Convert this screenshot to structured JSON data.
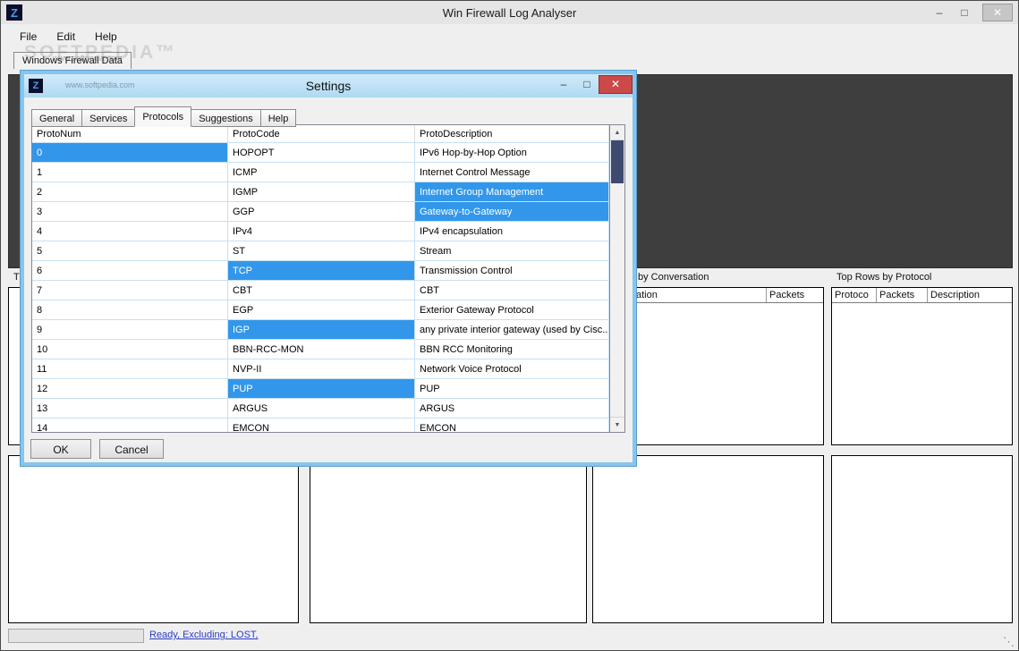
{
  "window": {
    "title": "Win Firewall Log Analyser",
    "menu_items": [
      "File",
      "Edit",
      "Help"
    ],
    "tab_label": "Windows Firewall Data",
    "watermark_large": "SOFTPEDIA™",
    "watermark_small": "www.softpedia.com",
    "controls": {
      "minimize": "–",
      "maximize": "□",
      "close": "✕"
    }
  },
  "panels": {
    "left": {
      "title_fragment": "T"
    },
    "conversation": {
      "title_fragment": "by Conversation",
      "col1_fragment": "ation",
      "col2": "Packets"
    },
    "protocol": {
      "title": "Top Rows by Protocol",
      "columns": [
        "Protoco",
        "Packets",
        "Description"
      ]
    }
  },
  "statusbar": {
    "link": "Ready, Excluding: LOST,"
  },
  "dialog": {
    "title": "Settings",
    "tabs": [
      "General",
      "Services",
      "Protocols",
      "Suggestions",
      "Help"
    ],
    "active_tab": "Protocols",
    "controls": {
      "minimize": "–",
      "maximize": "□",
      "close": "✕"
    },
    "scroll": {
      "up": "▲",
      "down": "▼"
    },
    "table": {
      "columns": [
        "ProtoNum",
        "ProtoCode",
        "ProtoDescription"
      ],
      "rows": [
        {
          "num": "0",
          "code": "HOPOPT",
          "desc": "IPv6 Hop-by-Hop Option",
          "hl": "num"
        },
        {
          "num": "1",
          "code": "ICMP",
          "desc": "Internet Control Message",
          "hl": ""
        },
        {
          "num": "2",
          "code": "IGMP",
          "desc": "Internet Group Management",
          "hl": "desc"
        },
        {
          "num": "3",
          "code": "GGP",
          "desc": "Gateway-to-Gateway",
          "hl": "desc"
        },
        {
          "num": "4",
          "code": "IPv4",
          "desc": "IPv4 encapsulation",
          "hl": ""
        },
        {
          "num": "5",
          "code": "ST",
          "desc": "Stream",
          "hl": ""
        },
        {
          "num": "6",
          "code": "TCP",
          "desc": "Transmission Control",
          "hl": "code"
        },
        {
          "num": "7",
          "code": "CBT",
          "desc": "CBT",
          "hl": ""
        },
        {
          "num": "8",
          "code": "EGP",
          "desc": "Exterior Gateway Protocol",
          "hl": ""
        },
        {
          "num": "9",
          "code": "IGP",
          "desc": "any private interior gateway (used by Cisc...",
          "hl": "code"
        },
        {
          "num": "10",
          "code": "BBN-RCC-MON",
          "desc": "BBN RCC Monitoring",
          "hl": ""
        },
        {
          "num": "11",
          "code": "NVP-II",
          "desc": "Network Voice Protocol",
          "hl": ""
        },
        {
          "num": "12",
          "code": "PUP",
          "desc": "PUP",
          "hl": "code"
        },
        {
          "num": "13",
          "code": "ARGUS",
          "desc": "ARGUS",
          "hl": ""
        },
        {
          "num": "14",
          "code": "EMCON",
          "desc": "EMCON",
          "hl": ""
        }
      ]
    },
    "buttons": {
      "ok": "OK",
      "cancel": "Cancel"
    }
  },
  "colors": {
    "selection_blue": "#3297ea",
    "dialog_border_blue": "#87c5ec",
    "dialog_titlebar_blue": "#bfe2f6",
    "close_red": "#cb4a47",
    "link_blue": "#2b3cc4",
    "dark_panel": "#3e3e3e",
    "scroll_thumb": "#3e4a70"
  },
  "logo_letter": "Z"
}
